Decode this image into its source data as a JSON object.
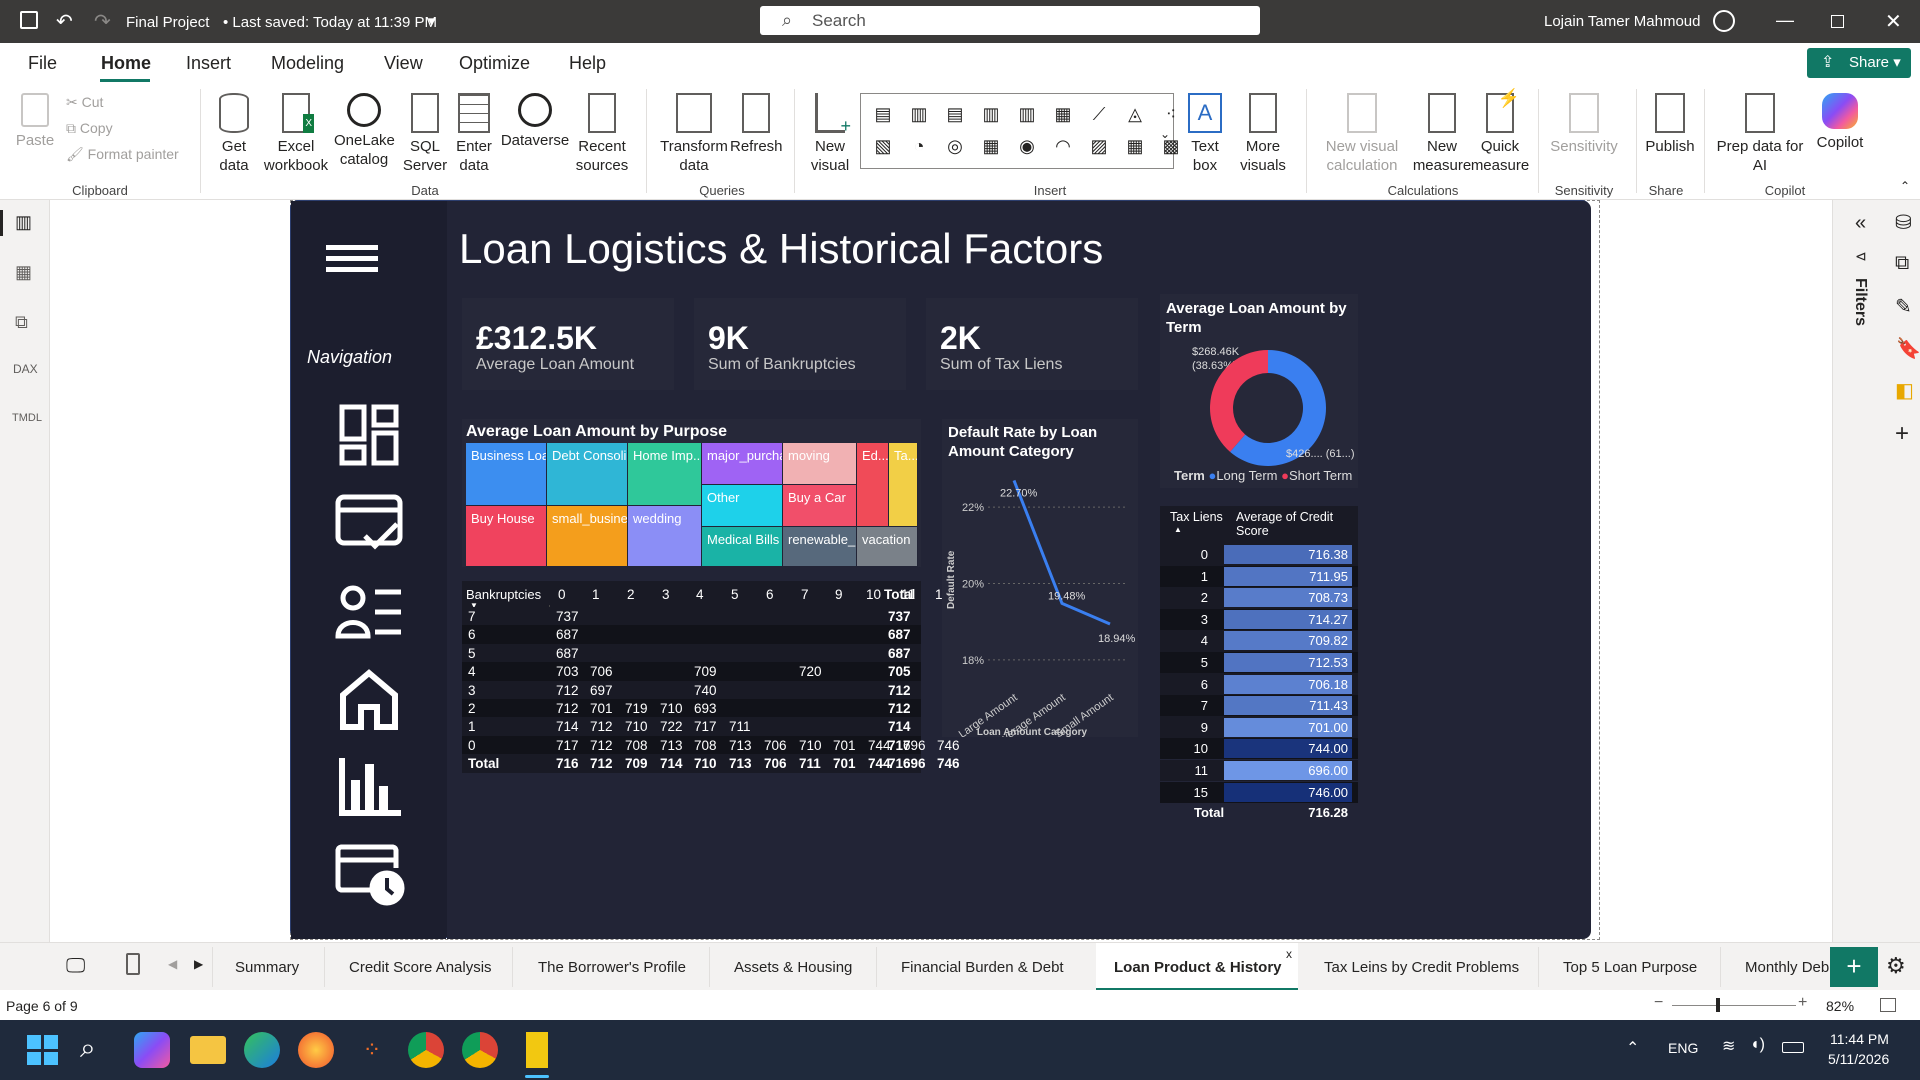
{
  "window": {
    "title": "Final Project",
    "saved": "• Last saved: Today at 11:39 PM",
    "user": "Lojain Tamer Mahmoud"
  },
  "search": {
    "placeholder": "Search"
  },
  "menu": [
    "File",
    "Home",
    "Insert",
    "Modeling",
    "View",
    "Optimize",
    "Help"
  ],
  "share_label": "Share",
  "ribbon": {
    "clipboard": {
      "paste": "Paste",
      "cut": "Cut",
      "copy": "Copy",
      "format_painter": "Format painter",
      "group": "Clipboard"
    },
    "data": {
      "get_data": "Get data",
      "excel": "Excel workbook",
      "onelake": "OneLake catalog",
      "sql": "SQL Server",
      "enter": "Enter data",
      "dataverse": "Dataverse",
      "recent": "Recent sources",
      "group": "Data"
    },
    "queries": {
      "transform": "Transform data",
      "refresh": "Refresh",
      "group": "Queries"
    },
    "insert": {
      "new_visual": "New visual",
      "text_box": "Text box",
      "more_visuals": "More visuals",
      "group": "Insert"
    },
    "calculations": {
      "new_visual_calc": "New visual calculation",
      "new_measure": "New measure",
      "quick_measure": "Quick measure",
      "group": "Calculations"
    },
    "sensitivity": {
      "label": "Sensitivity",
      "group": "Sensitivity"
    },
    "share": {
      "publish": "Publish",
      "group": "Share"
    },
    "copilot": {
      "prep": "Prep data for AI",
      "copilot": "Copilot",
      "group": "Copilot"
    }
  },
  "filters_label": "Filters",
  "report": {
    "title": "Loan Logistics & Historical Factors",
    "nav_label": "Navigation",
    "kpis": [
      {
        "value": "£312.5K",
        "label": "Average Loan Amount"
      },
      {
        "value": "9K",
        "label": "Sum of Bankruptcies"
      },
      {
        "value": "2K",
        "label": "Sum of Tax Liens"
      }
    ],
    "donut": {
      "title": "Average Loan Amount by Term",
      "label1": "$268.46K",
      "label1b": "(38.63%)",
      "label2": "$426.... (61...)",
      "legend_title": "Term",
      "legend": [
        "Long Term",
        "Short Term"
      ],
      "colors": {
        "long": "#3a7ff0",
        "short": "#ef3b5a"
      }
    },
    "treemap": {
      "title": "Average Loan Amount by Purpose",
      "cells": [
        "Business Loan",
        "Debt Consoli...",
        "Home Imp...",
        "major_purcha...",
        "moving",
        "Ed...",
        "Ta...",
        "Buy House",
        "small_busine...",
        "wedding",
        "Other",
        "Buy a Car",
        "Medical Bills",
        "renewable_...",
        "vacation"
      ]
    },
    "matrix": {
      "corner": "Bankruptcies",
      "cols": [
        "0",
        "1",
        "2",
        "3",
        "4",
        "5",
        "6",
        "7",
        "9",
        "10",
        "11",
        "15",
        "Total"
      ],
      "rows": [
        {
          "h": "7",
          "v": [
            "737",
            "",
            "",
            "",
            "",
            "",
            "",
            "",
            "",
            "",
            "",
            "",
            "737"
          ]
        },
        {
          "h": "6",
          "v": [
            "687",
            "",
            "",
            "",
            "",
            "",
            "",
            "",
            "",
            "",
            "",
            "",
            "687"
          ]
        },
        {
          "h": "5",
          "v": [
            "687",
            "",
            "",
            "",
            "",
            "",
            "",
            "",
            "",
            "",
            "",
            "",
            "687"
          ]
        },
        {
          "h": "4",
          "v": [
            "703",
            "706",
            "",
            "",
            "709",
            "",
            "",
            "720",
            "",
            "",
            "",
            "",
            "705"
          ]
        },
        {
          "h": "3",
          "v": [
            "712",
            "697",
            "",
            "",
            "740",
            "",
            "",
            "",
            "",
            "",
            "",
            "",
            "712"
          ]
        },
        {
          "h": "2",
          "v": [
            "712",
            "701",
            "719",
            "710",
            "693",
            "",
            "",
            "",
            "",
            "",
            "",
            "",
            "712"
          ]
        },
        {
          "h": "1",
          "v": [
            "714",
            "712",
            "710",
            "722",
            "717",
            "711",
            "",
            "",
            "",
            "",
            "",
            "",
            "714"
          ]
        },
        {
          "h": "0",
          "v": [
            "717",
            "712",
            "708",
            "713",
            "708",
            "713",
            "706",
            "710",
            "701",
            "744",
            "696",
            "746",
            "717"
          ]
        },
        {
          "h": "Total",
          "v": [
            "716",
            "712",
            "709",
            "714",
            "710",
            "713",
            "706",
            "711",
            "701",
            "744",
            "696",
            "746",
            "716"
          ]
        }
      ]
    },
    "line": {
      "title": "Default Rate by Loan Amount Category",
      "ylabel": "Default Rate",
      "xlabel": "Loan Amount Category",
      "yticks": [
        "22%",
        "20%",
        "18%"
      ],
      "categories": [
        "Large Amount",
        "Average Amount",
        "Small Amount"
      ],
      "labels": [
        "22.70%",
        "19.48%",
        "18.94%"
      ]
    },
    "credit": {
      "h1": "Tax Liens",
      "h2": "Average of Credit Score",
      "rows": [
        [
          "0",
          "716.38"
        ],
        [
          "1",
          "711.95"
        ],
        [
          "2",
          "708.73"
        ],
        [
          "3",
          "714.27"
        ],
        [
          "4",
          "709.82"
        ],
        [
          "5",
          "712.53"
        ],
        [
          "6",
          "706.18"
        ],
        [
          "7",
          "711.43"
        ],
        [
          "9",
          "701.00"
        ],
        [
          "10",
          "744.00"
        ],
        [
          "11",
          "696.00"
        ],
        [
          "15",
          "746.00"
        ]
      ],
      "total_label": "Total",
      "total": "716.28"
    }
  },
  "chart_data": [
    {
      "type": "pie",
      "title": "Average Loan Amount by Term",
      "categories": [
        "Long Term",
        "Short Term"
      ],
      "values": [
        268.46,
        426
      ],
      "percent": [
        38.63,
        61.37
      ]
    },
    {
      "type": "line",
      "title": "Default Rate by Loan Amount Category",
      "categories": [
        "Large Amount",
        "Average Amount",
        "Small Amount"
      ],
      "values": [
        22.7,
        19.48,
        18.94
      ],
      "xlabel": "Loan Amount Category",
      "ylabel": "Default Rate",
      "ylim": [
        17.5,
        23
      ]
    },
    {
      "type": "table",
      "title": "Tax Liens vs Average of Credit Score",
      "categories": [
        "0",
        "1",
        "2",
        "3",
        "4",
        "5",
        "6",
        "7",
        "9",
        "10",
        "11",
        "15"
      ],
      "values": [
        716.38,
        711.95,
        708.73,
        714.27,
        709.82,
        712.53,
        706.18,
        711.43,
        701.0,
        744.0,
        696.0,
        746.0
      ]
    }
  ],
  "tabs": [
    "Summary",
    "Credit Score Analysis",
    "The Borrower's Profile",
    "Assets & Housing",
    "Financial Burden & Debt",
    "Loan Product & History",
    "Tax Leins by Credit Problems",
    "Top 5 Loan Purpose",
    "Monthly Deb"
  ],
  "status": {
    "page": "Page 6 of 9",
    "zoom": "82%"
  },
  "taskbar": {
    "lang": "ENG",
    "time": "11:44 PM",
    "date": "5/11/2026"
  }
}
